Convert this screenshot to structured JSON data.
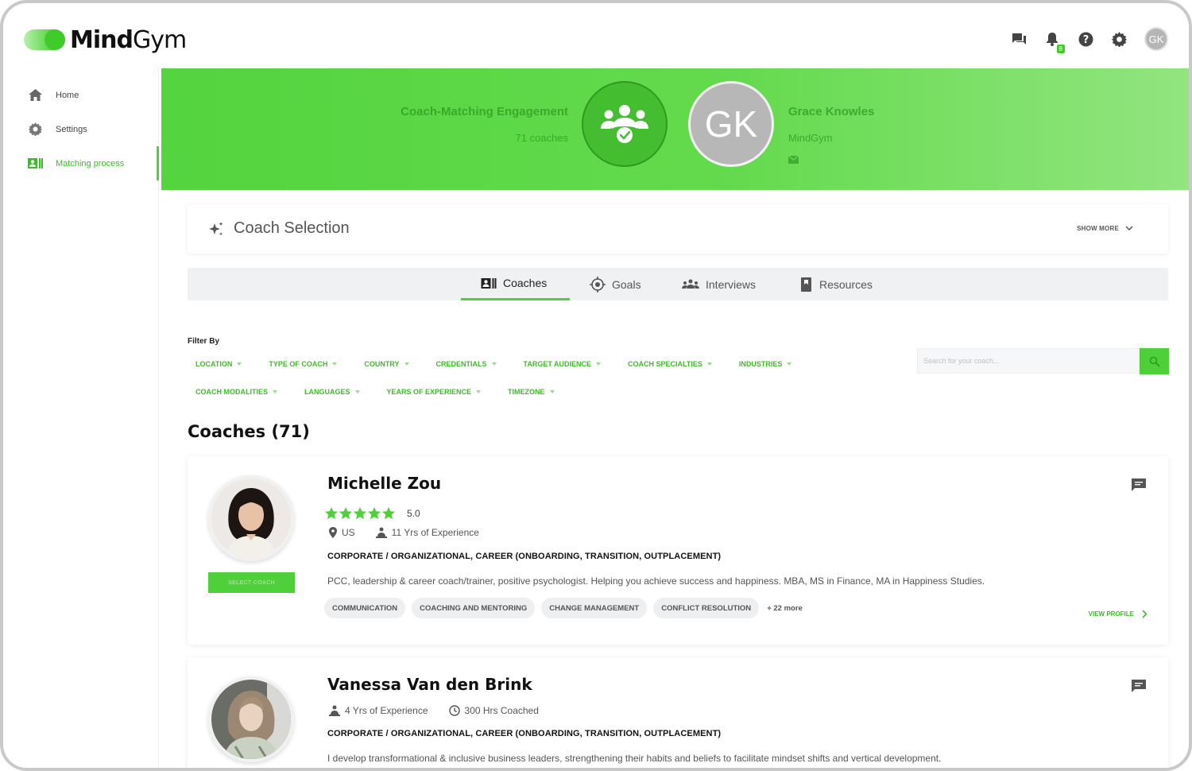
{
  "brand": {
    "name_bold": "Mind",
    "name_light": "Gym"
  },
  "header": {
    "notification_count": "8",
    "avatar_initials": "GK"
  },
  "sidebar": {
    "items": [
      {
        "label": "Home",
        "icon": "home-icon"
      },
      {
        "label": "Settings",
        "icon": "gear-icon"
      },
      {
        "label": "Matching process",
        "icon": "matching-icon",
        "active": true
      }
    ]
  },
  "hero": {
    "engagement_title": "Coach-Matching Engagement",
    "coach_count": "71 coaches",
    "user_initials": "GK",
    "user_name": "Grace Knowles",
    "user_org": "MindGym"
  },
  "selection": {
    "title": "Coach Selection",
    "show_more": "SHOW MORE"
  },
  "tabs": [
    {
      "label": "Coaches",
      "icon": "coaches-icon",
      "active": true
    },
    {
      "label": "Goals",
      "icon": "goals-icon"
    },
    {
      "label": "Interviews",
      "icon": "interviews-icon"
    },
    {
      "label": "Resources",
      "icon": "resources-icon"
    }
  ],
  "filters": {
    "label": "Filter By",
    "row1": [
      "LOCATION",
      "TYPE OF COACH",
      "COUNTRY",
      "CREDENTIALS",
      "TARGET AUDIENCE",
      "COACH SPECIALTIES",
      "INDUSTRIES"
    ],
    "row2": [
      "COACH MODALITIES",
      "LANGUAGES",
      "YEARS OF EXPERIENCE",
      "TIMEZONE"
    ],
    "search_placeholder": "Search for your coach..."
  },
  "coaches_heading": "Coaches (71)",
  "coaches": [
    {
      "name": "Michelle Zou",
      "rating": "5.0",
      "stars": 5,
      "location": "US",
      "experience": "11 Yrs of Experience",
      "category": "CORPORATE / ORGANIZATIONAL, CAREER (ONBOARDING, TRANSITION, OUTPLACEMENT)",
      "bio": "PCC, leadership & career coach/trainer, positive psychologist. Helping you achieve success and happiness. MBA, MS in Finance, MA in Happiness Studies.",
      "tags": [
        "COMMUNICATION",
        "COACHING AND MENTORING",
        "CHANGE MANAGEMENT",
        "CONFLICT RESOLUTION"
      ],
      "more_tags": "+ 22 more",
      "select_label": "SELECT COACH",
      "view_profile": "VIEW PROFILE"
    },
    {
      "name": "Vanessa Van den Brink",
      "experience": "4 Yrs of Experience",
      "hours": "300 Hrs Coached",
      "category": "CORPORATE / ORGANIZATIONAL, CAREER (ONBOARDING, TRANSITION, OUTPLACEMENT)",
      "bio": "I develop transformational & inclusive business leaders, strengthening their habits and beliefs to facilitate mindset shifts and vertical development."
    }
  ],
  "colors": {
    "accent": "#4fd13b",
    "accent_text": "#3dbb27",
    "hero_text": "#2f9a22"
  }
}
